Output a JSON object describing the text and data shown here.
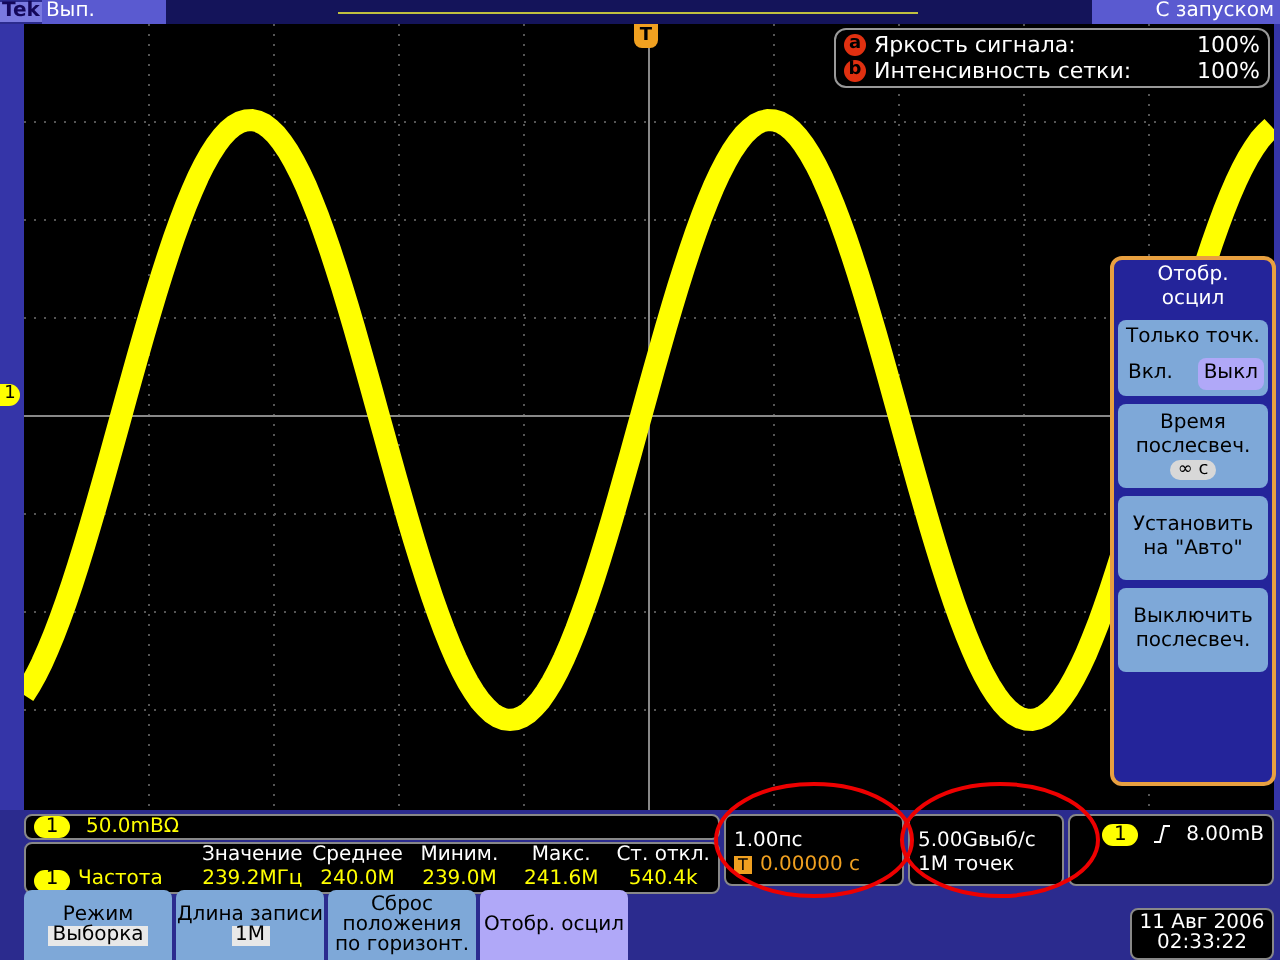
{
  "top_bar": {
    "brand": "Tek",
    "run_state": "Вып.",
    "trigger_mode": "С запуском"
  },
  "display_info": [
    {
      "marker": "a",
      "label": "Яркость сигнала:",
      "value": "100%"
    },
    {
      "marker": "b",
      "label": "Интенсивность сетки:",
      "value": "100%"
    }
  ],
  "channel_marker": "1",
  "trigger_marker": "T",
  "side_menu": {
    "title": "Отобр. осцил",
    "items": [
      {
        "kind": "toggle",
        "label": "Только точк.",
        "options": [
          {
            "label": "Вкл.",
            "selected": false
          },
          {
            "label": "Выкл",
            "selected": true
          }
        ]
      },
      {
        "kind": "value",
        "label": "Время послесвеч.",
        "value": "∞ c"
      },
      {
        "kind": "action",
        "label": "Установить на \"Авто\""
      },
      {
        "kind": "action",
        "label": "Выключить послесвеч."
      }
    ]
  },
  "channel_readout": {
    "channel": "1",
    "scale": "50.0mВΩ"
  },
  "measurements": {
    "channel": "1",
    "name": "Частота",
    "columns": [
      {
        "heading": "Значение",
        "value": "239.2MГц"
      },
      {
        "heading": "Среднее",
        "value": "240.0M"
      },
      {
        "heading": "Миним.",
        "value": "239.0M"
      },
      {
        "heading": "Макс.",
        "value": "241.6M"
      },
      {
        "heading": "Ст. откл.",
        "value": "540.4k"
      }
    ]
  },
  "horizontal": {
    "scale": "1.00пс",
    "trigger_icon": "T",
    "delay": "0.00000 с"
  },
  "acquisition": {
    "rate": "5.00Gвыб/с",
    "length": "1M точек"
  },
  "trigger": {
    "channel": "1",
    "level": "8.00mВ"
  },
  "buttons": [
    {
      "title": "Режим",
      "value": "Выборка",
      "selected": false
    },
    {
      "title": "Длина записи",
      "value": "1M",
      "selected": false
    },
    {
      "title": "Сброс положения по горизонт.",
      "selected": false
    },
    {
      "title": "Отобр. осцил",
      "selected": true
    }
  ],
  "datetime": {
    "date": "11 Авг 2006",
    "time": "02:33:22"
  }
}
